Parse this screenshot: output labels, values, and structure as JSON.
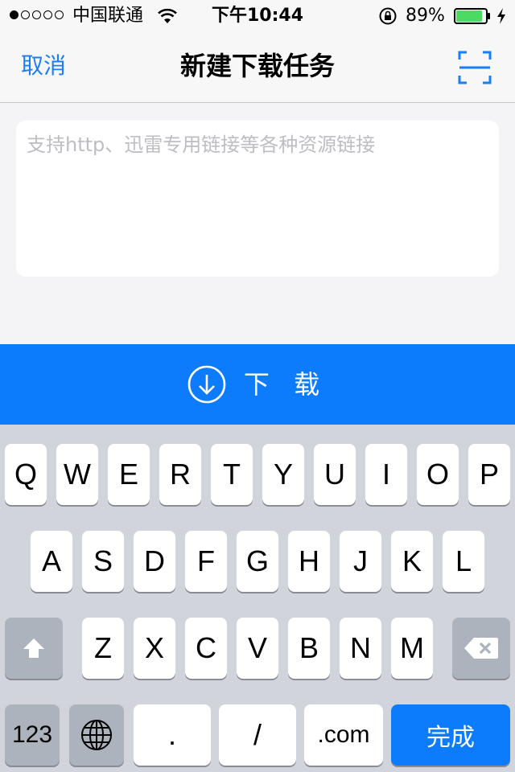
{
  "status_bar": {
    "carrier": "中国联通",
    "time": "下午10:44",
    "battery_percent": "89%",
    "battery_level": 0.89,
    "signal_bars_filled": 1,
    "signal_bars_total": 5
  },
  "nav": {
    "cancel_label": "取消",
    "title": "新建下载任务",
    "scan_icon": "scan-icon"
  },
  "url_input": {
    "value": "",
    "placeholder": "支持http、迅雷专用链接等各种资源链接"
  },
  "download_button": {
    "label": "下 载",
    "icon": "download-circle-icon"
  },
  "keyboard": {
    "row1": [
      "Q",
      "W",
      "E",
      "R",
      "T",
      "Y",
      "U",
      "I",
      "O",
      "P"
    ],
    "row2": [
      "A",
      "S",
      "D",
      "F",
      "G",
      "H",
      "J",
      "K",
      "L"
    ],
    "row3": [
      "Z",
      "X",
      "C",
      "V",
      "B",
      "N",
      "M"
    ],
    "shift_icon": "shift-icon",
    "backspace_icon": "backspace-icon",
    "numbers_label": "123",
    "globe_icon": "globe-icon",
    "dot_label": ".",
    "slash_label": "/",
    "dotcom_label": ".com",
    "done_label": "完成"
  },
  "colors": {
    "accent": "#0d7cfc",
    "link": "#1a7dfa",
    "battery": "#4cd964"
  }
}
